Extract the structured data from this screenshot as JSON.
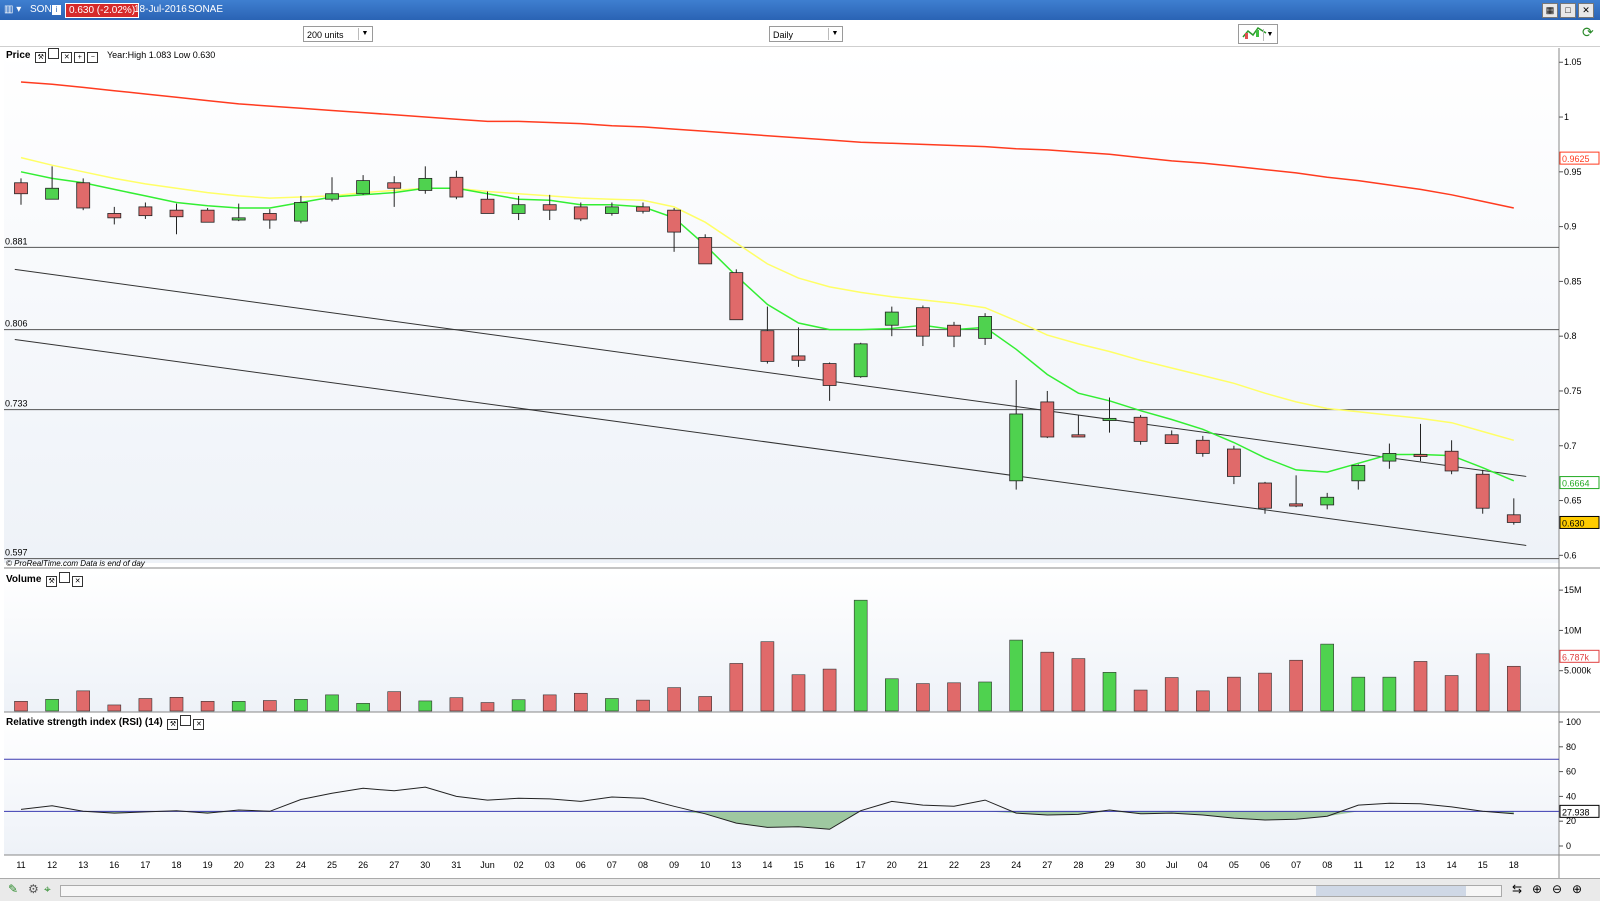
{
  "window": {
    "symbol": "SON",
    "price_change": "0.630 (-2.02%)",
    "date": "18-Jul-2016",
    "name": "SONAE"
  },
  "toolbar": {
    "units": "200 units",
    "period": "Daily"
  },
  "price_panel": {
    "label": "Price",
    "year_info": "Year:High 1.083 Low 0.630",
    "footer": "© ProRealTime.com  Data is end of day"
  },
  "volume_panel": {
    "label": "Volume"
  },
  "rsi_panel": {
    "label": "Relative strength index (RSI) (14)"
  },
  "colors": {
    "up": "#4fd24f",
    "down": "#e06a6a",
    "ma_red": "#ff3b1f",
    "ma_yellow": "#ffff66",
    "ma_green": "#33ee33",
    "rsi_line": "#2a2aa0",
    "badge_last": "#ffcc00"
  },
  "chart_data": [
    {
      "type": "candlestick",
      "title": "",
      "x": [
        "11",
        "12",
        "13",
        "16",
        "17",
        "18",
        "19",
        "20",
        "23",
        "24",
        "25",
        "26",
        "27",
        "30",
        "31",
        "Jun",
        "02",
        "03",
        "06",
        "07",
        "08",
        "09",
        "10",
        "13",
        "14",
        "15",
        "16",
        "17",
        "20",
        "21",
        "22",
        "23",
        "24",
        "27",
        "28",
        "29",
        "30",
        "Jul",
        "04",
        "05",
        "06",
        "07",
        "08",
        "11",
        "12",
        "13",
        "14",
        "15",
        "18"
      ],
      "open": [
        0.94,
        0.925,
        0.94,
        0.912,
        0.918,
        0.915,
        0.915,
        0.906,
        0.912,
        0.905,
        0.925,
        0.93,
        0.94,
        0.933,
        0.945,
        0.925,
        0.912,
        0.92,
        0.918,
        0.912,
        0.918,
        0.915,
        0.89,
        0.858,
        0.805,
        0.782,
        0.775,
        0.763,
        0.81,
        0.826,
        0.81,
        0.798,
        0.668,
        0.74,
        0.71,
        0.723,
        0.726,
        0.71,
        0.705,
        0.697,
        0.666,
        0.647,
        0.646,
        0.668,
        0.686,
        0.692,
        0.695,
        0.674,
        0.637
      ],
      "high": [
        0.944,
        0.955,
        0.944,
        0.918,
        0.922,
        0.921,
        0.917,
        0.921,
        0.916,
        0.928,
        0.945,
        0.947,
        0.946,
        0.955,
        0.951,
        0.932,
        0.928,
        0.929,
        0.922,
        0.922,
        0.922,
        0.917,
        0.893,
        0.861,
        0.827,
        0.808,
        0.776,
        0.794,
        0.827,
        0.828,
        0.813,
        0.821,
        0.76,
        0.75,
        0.728,
        0.744,
        0.728,
        0.714,
        0.709,
        0.7,
        0.667,
        0.673,
        0.657,
        0.683,
        0.702,
        0.72,
        0.705,
        0.678,
        0.652
      ],
      "low": [
        0.92,
        0.925,
        0.915,
        0.902,
        0.907,
        0.893,
        0.904,
        0.905,
        0.898,
        0.903,
        0.923,
        0.929,
        0.918,
        0.93,
        0.925,
        0.912,
        0.906,
        0.906,
        0.905,
        0.91,
        0.912,
        0.877,
        0.866,
        0.815,
        0.775,
        0.772,
        0.741,
        0.762,
        0.8,
        0.791,
        0.79,
        0.792,
        0.66,
        0.707,
        0.708,
        0.712,
        0.701,
        0.704,
        0.69,
        0.665,
        0.638,
        0.644,
        0.642,
        0.66,
        0.679,
        0.686,
        0.674,
        0.638,
        0.628
      ],
      "close": [
        0.93,
        0.935,
        0.917,
        0.908,
        0.91,
        0.909,
        0.904,
        0.908,
        0.906,
        0.922,
        0.93,
        0.942,
        0.935,
        0.944,
        0.927,
        0.912,
        0.92,
        0.915,
        0.907,
        0.918,
        0.914,
        0.895,
        0.866,
        0.815,
        0.777,
        0.778,
        0.755,
        0.793,
        0.822,
        0.8,
        0.8,
        0.818,
        0.729,
        0.708,
        0.708,
        0.725,
        0.704,
        0.702,
        0.693,
        0.672,
        0.643,
        0.645,
        0.653,
        0.682,
        0.693,
        0.691,
        0.677,
        0.643,
        0.63
      ],
      "volume": [
        1.2,
        1.45,
        2.5,
        0.75,
        1.55,
        1.7,
        1.2,
        1.2,
        1.3,
        1.45,
        2.0,
        0.95,
        2.4,
        1.25,
        1.65,
        1.05,
        1.4,
        2.0,
        2.2,
        1.55,
        1.35,
        2.9,
        1.8,
        5.9,
        8.6,
        4.5,
        5.2,
        13.75,
        4.0,
        3.4,
        3.5,
        3.6,
        8.8,
        7.3,
        6.5,
        4.8,
        2.6,
        4.15,
        2.5,
        4.2,
        4.7,
        6.3,
        8.3,
        4.2,
        4.2,
        6.15,
        4.4,
        7.1,
        5.55
      ],
      "ma_red": [
        1.032,
        1.03,
        1.027,
        1.024,
        1.021,
        1.018,
        1.015,
        1.012,
        1.01,
        1.008,
        1.006,
        1.004,
        1.002,
        1.0,
        0.998,
        0.996,
        0.996,
        0.995,
        0.994,
        0.992,
        0.991,
        0.989,
        0.987,
        0.985,
        0.983,
        0.981,
        0.979,
        0.977,
        0.976,
        0.975,
        0.974,
        0.973,
        0.971,
        0.97,
        0.968,
        0.966,
        0.963,
        0.96,
        0.958,
        0.955,
        0.952,
        0.949,
        0.945,
        0.942,
        0.938,
        0.934,
        0.929,
        0.923,
        0.917
      ],
      "ma_yellow": [
        0.963,
        0.956,
        0.95,
        0.944,
        0.939,
        0.935,
        0.931,
        0.928,
        0.926,
        0.927,
        0.928,
        0.931,
        0.933,
        0.935,
        0.935,
        0.932,
        0.93,
        0.928,
        0.926,
        0.925,
        0.924,
        0.918,
        0.904,
        0.885,
        0.866,
        0.853,
        0.845,
        0.84,
        0.836,
        0.833,
        0.83,
        0.826,
        0.814,
        0.801,
        0.793,
        0.786,
        0.778,
        0.771,
        0.764,
        0.757,
        0.748,
        0.74,
        0.734,
        0.731,
        0.728,
        0.725,
        0.721,
        0.713,
        0.705
      ],
      "ma_green": [
        0.95,
        0.944,
        0.94,
        0.934,
        0.928,
        0.922,
        0.919,
        0.917,
        0.917,
        0.922,
        0.927,
        0.929,
        0.931,
        0.935,
        0.935,
        0.93,
        0.925,
        0.924,
        0.92,
        0.92,
        0.918,
        0.908,
        0.883,
        0.855,
        0.829,
        0.812,
        0.806,
        0.806,
        0.807,
        0.81,
        0.806,
        0.808,
        0.788,
        0.765,
        0.748,
        0.741,
        0.732,
        0.724,
        0.715,
        0.703,
        0.689,
        0.678,
        0.676,
        0.684,
        0.692,
        0.692,
        0.691,
        0.68,
        0.668
      ],
      "rsi": [
        29.5,
        32.5,
        28.0,
        26.5,
        27.5,
        28.5,
        26.5,
        29.0,
        28.0,
        37.5,
        42.5,
        46.5,
        44.5,
        47.5,
        40.0,
        37.0,
        38.5,
        38.0,
        36.0,
        39.5,
        38.5,
        32.0,
        26.0,
        18.5,
        15.0,
        15.5,
        13.5,
        28.5,
        36.0,
        33.0,
        32.0,
        37.0,
        26.5,
        25.0,
        25.5,
        29.0,
        26.0,
        26.5,
        25.0,
        22.5,
        21.0,
        21.5,
        24.0,
        33.0,
        34.5,
        34.0,
        31.5,
        28.0,
        26.0
      ],
      "rsi_levels": [
        70,
        27.938
      ],
      "price_ylim": [
        0.593,
        1.063
      ],
      "price_ticks": [
        "1.05",
        "1",
        "0.95",
        "0.9",
        "0.85",
        "0.8",
        "0.75",
        "0.7",
        "0.65",
        "0.6"
      ],
      "volume_ticks": [
        "15M",
        "10M",
        "5.000k"
      ],
      "volume_ylim": [
        0,
        17
      ],
      "rsi_ticks": [
        "100",
        "80",
        "60",
        "40",
        "20",
        "0"
      ],
      "hlines": [
        {
          "label": "0.881",
          "value": 0.881
        },
        {
          "label": "0.806",
          "value": 0.806
        },
        {
          "label": "0.733",
          "value": 0.733
        },
        {
          "label": "0.597",
          "value": 0.597
        }
      ],
      "trendlines": [
        {
          "from": [
            -0.2,
            0.861
          ],
          "to": [
            48.4,
            0.672
          ]
        },
        {
          "from": [
            -0.2,
            0.797
          ],
          "to": [
            48.4,
            0.609
          ]
        }
      ],
      "right_badges": [
        {
          "text": "0.9625",
          "value": 0.9625,
          "color": "#ff3b1f",
          "bg": "#ffffff"
        },
        {
          "text": "0.6664",
          "value": 0.6664,
          "color": "#22aa22",
          "bg": "#ffffff"
        },
        {
          "text": "0.630",
          "value": 0.63,
          "color": "#000000",
          "bg": "#ffcc00"
        },
        {
          "text": "6.787k",
          "value": 6.787,
          "color": "#e04040",
          "bg": "#ffffff"
        },
        {
          "text": "27.938",
          "value": 27.938,
          "color": "#000000",
          "bg": "#ffffff"
        }
      ]
    }
  ]
}
